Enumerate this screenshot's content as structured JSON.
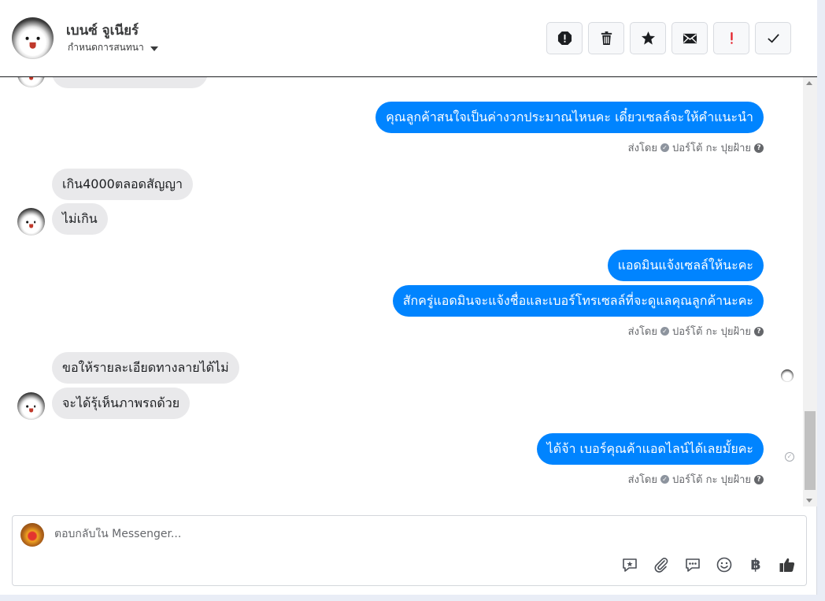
{
  "header": {
    "contact_name": "เบนซ์ จูเนียร์",
    "subtitle": "กำหนดการสนทนา",
    "toolbar": [
      {
        "name": "spam-button",
        "icon": "alert-octagon-icon"
      },
      {
        "name": "delete-button",
        "icon": "trash-icon"
      },
      {
        "name": "star-button",
        "icon": "star-icon"
      },
      {
        "name": "mark-unread-button",
        "icon": "envelope-icon"
      },
      {
        "name": "important-button",
        "icon": "exclamation-icon"
      },
      {
        "name": "done-button",
        "icon": "checkmark-icon"
      }
    ]
  },
  "messages": [
    {
      "dir": "out",
      "text": "คุณลูกค้าสนใจเป็นค่างวกประมาณไหนคะ เดี๋ยวเซลล์จะให้คำแนะนำ"
    },
    {
      "dir": "in",
      "text": "เกิน4000ตลอดสัญญา"
    },
    {
      "dir": "in",
      "text": "ไม่เกิน"
    },
    {
      "dir": "out",
      "text": "แอดมินแจ้งเซลล์ให้นะคะ"
    },
    {
      "dir": "out",
      "text": "สักครู่แอดมินจะแจ้งชื่อและเบอร์โทรเซลล์ที่จะดูแลคุณลูกค้านะคะ"
    },
    {
      "dir": "in",
      "text": "ขอให้รายละเอียดทางลายได้ไม่"
    },
    {
      "dir": "in",
      "text": "จะได้รุ้เห็นภาพรถด้วย"
    },
    {
      "dir": "out",
      "text": "ได้จ้า เบอร์คุณค้าแอดไลน์ได้เลยมั้ยคะ"
    }
  ],
  "sent_by": {
    "prefix": "ส่งโดย",
    "sender": "ปอร์โต้ กะ ปุยฝ้าย"
  },
  "composer": {
    "placeholder": "ตอบกลับใน Messenger...",
    "tools": [
      "saved-reply-icon",
      "attachment-icon",
      "chat-bubble-icon",
      "emoji-icon",
      "baht-icon",
      "thumbs-up-icon"
    ],
    "baht_symbol": "฿"
  },
  "colors": {
    "outgoing_bubble": "#0084ff",
    "incoming_bubble": "#e9e9eb",
    "important": "#e4202a"
  }
}
